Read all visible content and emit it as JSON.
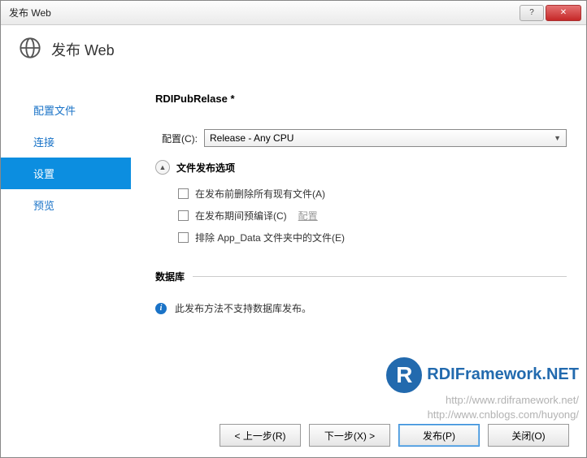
{
  "titlebar": {
    "title": "发布 Web",
    "help": "?",
    "close": "✕"
  },
  "header": {
    "title": "发布 Web"
  },
  "sidebar": {
    "items": [
      {
        "label": "配置文件"
      },
      {
        "label": "连接"
      },
      {
        "label": "设置"
      },
      {
        "label": "预览"
      }
    ]
  },
  "main": {
    "profile_name": "RDIPubRelase *",
    "config_label": "配置(C):",
    "config_value": "Release - Any CPU",
    "file_options_title": "文件发布选项",
    "checks": [
      {
        "label": "在发布前删除所有现有文件(A)"
      },
      {
        "label": "在发布期间预编译(C)",
        "link": "配置"
      },
      {
        "label": "排除 App_Data 文件夹中的文件(E)"
      }
    ],
    "db_title": "数据库",
    "db_message": "此发布方法不支持数据库发布。"
  },
  "footer": {
    "prev": "< 上一步(R)",
    "next": "下一步(X) >",
    "publish": "发布(P)",
    "close": "关闭(O)"
  },
  "watermark": {
    "logo": "R",
    "brand": "RDIFramework.NET",
    "url1": "http://www.rdiframework.net/",
    "url2": "http://www.cnblogs.com/huyong/"
  }
}
